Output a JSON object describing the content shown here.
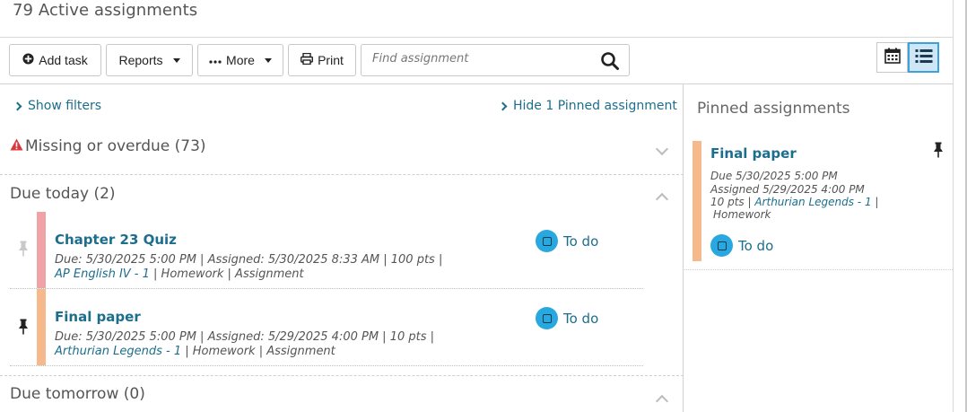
{
  "header": {
    "title": "79 Active assignments"
  },
  "toolbar": {
    "add_task_label": "Add task",
    "reports_label": "Reports",
    "more_label": "More",
    "print_label": "Print",
    "search_placeholder": "Find assignment"
  },
  "filters": {
    "show_filters_label": "Show filters",
    "hide_pinned_label": "Hide 1 Pinned assignment"
  },
  "sections": {
    "missing": {
      "title": "Missing or overdue (73)"
    },
    "today": {
      "title": "Due today (2)"
    },
    "tomorrow": {
      "title": "Due tomorrow (0)"
    }
  },
  "today_items": [
    {
      "title": "Chapter 23 Quiz",
      "meta_line1": "Due: 5/30/2025 5:00 PM | Assigned: 5/30/2025 8:33 AM | 100 pts  |",
      "course": "AP English IV - 1",
      "meta_line2_rest": " | Homework | Assignment",
      "status": "To do",
      "color": "#f0a3a6"
    },
    {
      "title": "Final paper",
      "meta_line1": "Due: 5/30/2025 5:00 PM | Assigned: 5/29/2025 4:00 PM | 10 pts  |",
      "course": "Arthurian Legends - 1",
      "meta_line2_rest": " | Homework | Assignment",
      "status": "To do",
      "color": "#f6b98c"
    }
  ],
  "pinned": {
    "title": "Pinned assignments",
    "item": {
      "title": "Final paper",
      "due": "Due 5/30/2025 5:00 PM",
      "assigned": "Assigned 5/29/2025 4:00 PM",
      "pts": "10 pts  |",
      "course": "Arthurian Legends - 1",
      "course_sep": " |",
      "type": "Homework",
      "status": "To do",
      "color": "#f6b98c"
    }
  },
  "colors": {
    "accent": "#1c6e8c",
    "todo_blue": "#29a8e0",
    "warning_red": "#d9363e"
  }
}
